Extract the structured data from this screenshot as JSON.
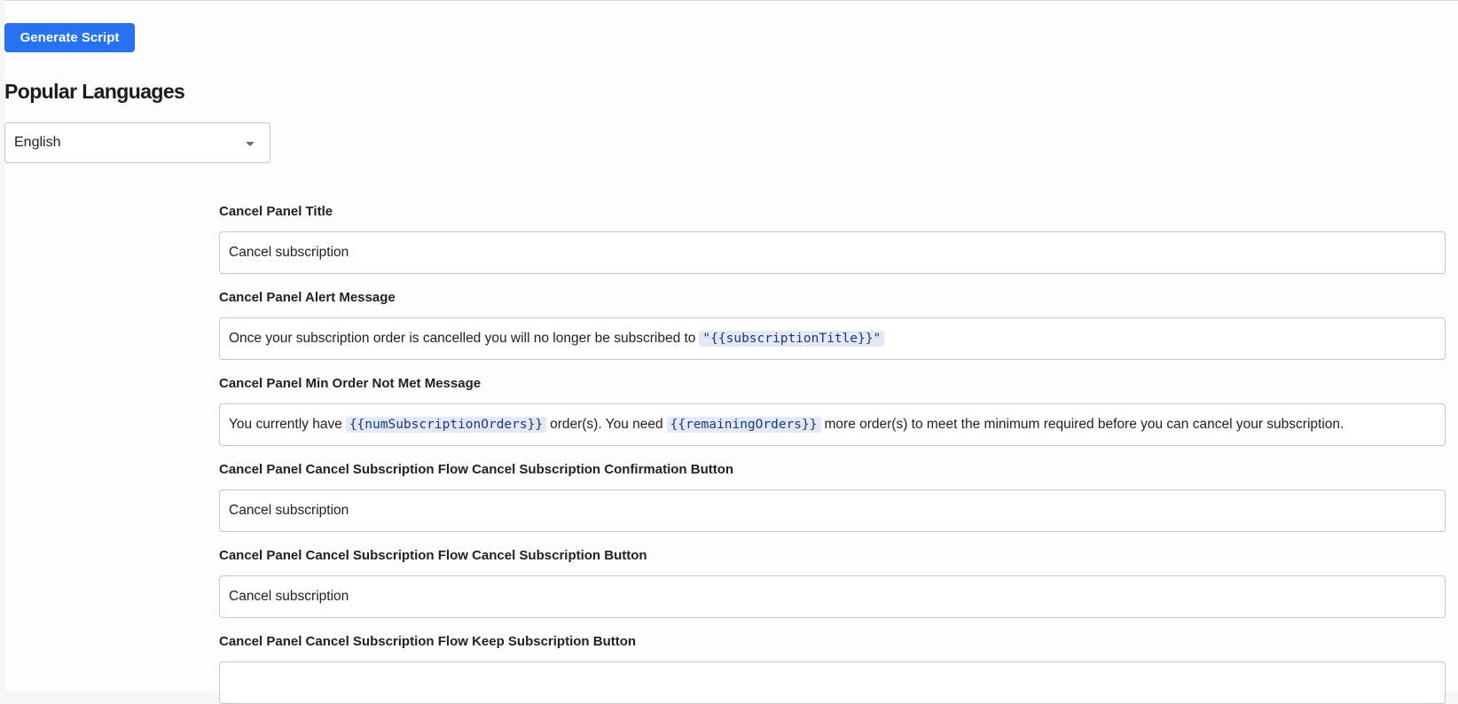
{
  "toolbar": {
    "generate_label": "Generate Script"
  },
  "languages": {
    "heading": "Popular Languages",
    "selected": "English"
  },
  "fields": [
    {
      "label": "Cancel Panel Title",
      "value": "Cancel subscription"
    },
    {
      "label": "Cancel Panel Alert Message",
      "text1": "Once your subscription order is cancelled you will no longer be subscribed to",
      "token1": "\"{{subscriptionTitle}}\""
    },
    {
      "label": "Cancel Panel Min Order Not Met Message",
      "text1": "You currently have",
      "token1": "{{numSubscriptionOrders}}",
      "text2": "order(s). You need",
      "token2": "{{remainingOrders}}",
      "text3": "more order(s) to meet the minimum required before you can cancel your subscription."
    },
    {
      "label": "Cancel Panel Cancel Subscription Flow Cancel Subscription Confirmation Button",
      "value": "Cancel subscription"
    },
    {
      "label": "Cancel Panel Cancel Subscription Flow Cancel Subscription Button",
      "value": "Cancel subscription"
    },
    {
      "label": "Cancel Panel Cancel Subscription Flow Keep Subscription Button",
      "value": ""
    }
  ]
}
